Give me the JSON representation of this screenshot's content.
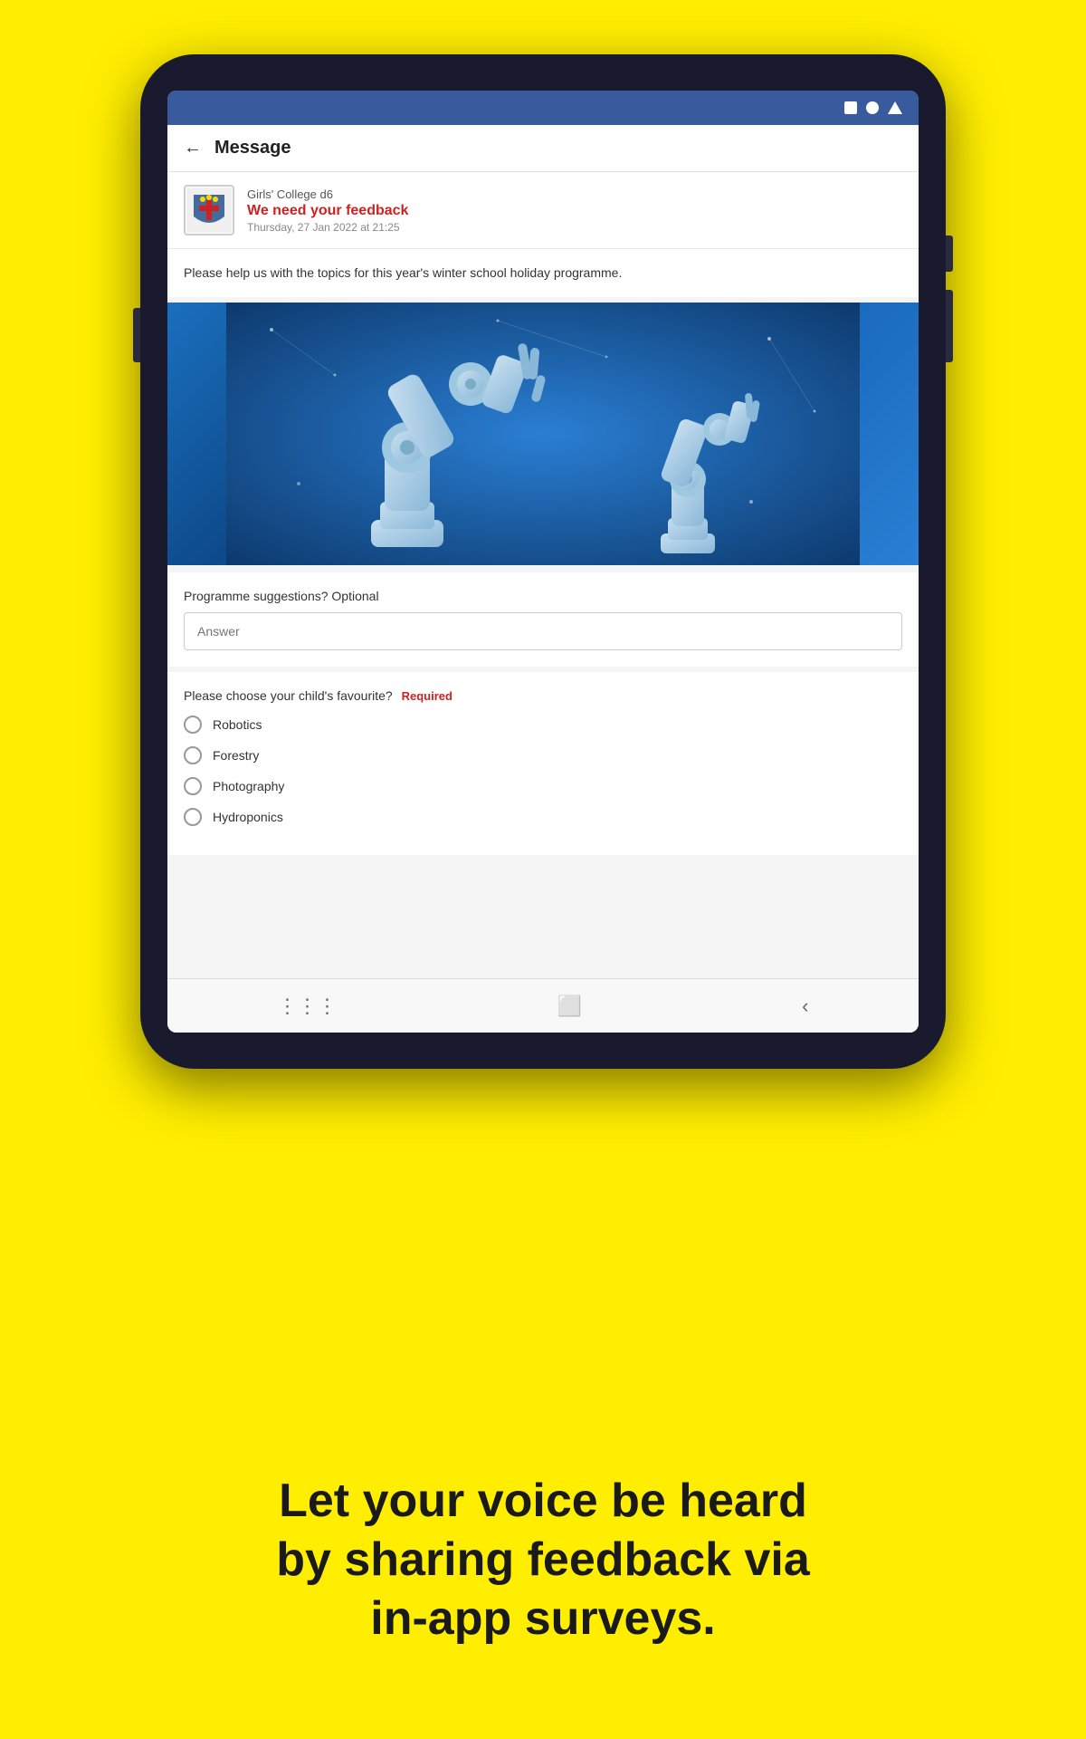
{
  "page": {
    "background_color": "#FFEE00"
  },
  "status_bar": {
    "icons": [
      "square",
      "circle",
      "wifi-triangle"
    ]
  },
  "header": {
    "back_label": "←",
    "title": "Message"
  },
  "sender": {
    "org": "Girls' College d6",
    "subject": "We need your feedback",
    "date": "Thursday, 27 Jan 2022 at 21:25"
  },
  "body": {
    "text": "Please help us with the topics for this year's winter school holiday programme."
  },
  "survey": {
    "label": "Programme suggestions? Optional",
    "input_placeholder": "Answer"
  },
  "radio_question": {
    "text": "Please choose your child's favourite?",
    "required_label": "Required",
    "options": [
      {
        "id": "robotics",
        "label": "Robotics"
      },
      {
        "id": "forestry",
        "label": "Forestry"
      },
      {
        "id": "photography",
        "label": "Photography"
      },
      {
        "id": "hydroponics",
        "label": "Hydroponics"
      }
    ]
  },
  "bottom_nav": {
    "items": [
      "menu-icon",
      "home-icon",
      "back-icon"
    ]
  },
  "tagline": {
    "line1": "Let your voice be heard",
    "line2": "by sharing feedback via",
    "line3": "in-app surveys."
  }
}
